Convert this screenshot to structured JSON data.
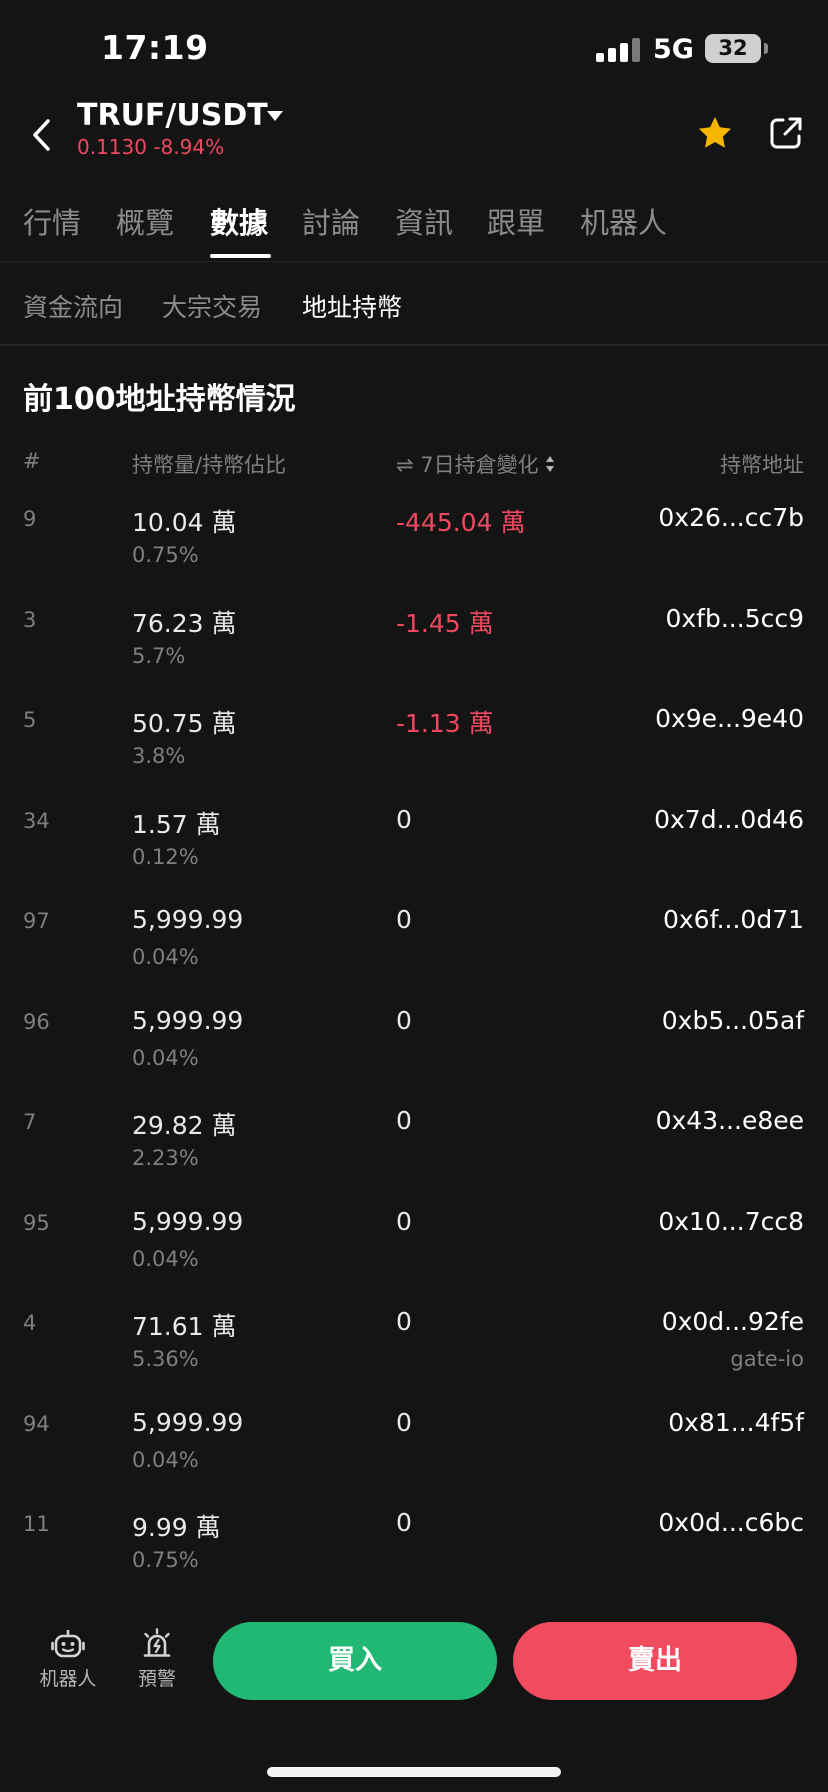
{
  "status_bar": {
    "time": "17:19",
    "network": "5G",
    "battery": "32"
  },
  "header": {
    "pair": "TRUF/USDT",
    "price_change": "0.1130 -8.94%"
  },
  "tabs": [
    {
      "label": "行情"
    },
    {
      "label": "概覽"
    },
    {
      "label": "數據",
      "active": true
    },
    {
      "label": "討論"
    },
    {
      "label": "資訊"
    },
    {
      "label": "跟單"
    },
    {
      "label": "机器人"
    }
  ],
  "subtabs": [
    {
      "label": "資金流向"
    },
    {
      "label": "大宗交易"
    },
    {
      "label": "地址持幣",
      "active": true
    }
  ],
  "section": {
    "title": "前100地址持幣情況",
    "columns": {
      "rank": "#",
      "holding": "持幣量/持幣佔比",
      "change_prefix": "⇌",
      "change": "7日持倉變化",
      "address": "持幣地址"
    }
  },
  "rows": [
    {
      "rank": "9",
      "amount": "10.04 萬",
      "pct": "0.75%",
      "change": "-445.04 萬",
      "negative": true,
      "address": "0x26...cc7b",
      "tag": ""
    },
    {
      "rank": "3",
      "amount": "76.23 萬",
      "pct": "5.7%",
      "change": "-1.45 萬",
      "negative": true,
      "address": "0xfb...5cc9",
      "tag": ""
    },
    {
      "rank": "5",
      "amount": "50.75 萬",
      "pct": "3.8%",
      "change": "-1.13 萬",
      "negative": true,
      "address": "0x9e...9e40",
      "tag": ""
    },
    {
      "rank": "34",
      "amount": "1.57 萬",
      "pct": "0.12%",
      "change": "0",
      "negative": false,
      "address": "0x7d...0d46",
      "tag": ""
    },
    {
      "rank": "97",
      "amount": "5,999.99",
      "pct": "0.04%",
      "change": "0",
      "negative": false,
      "address": "0x6f...0d71",
      "tag": ""
    },
    {
      "rank": "96",
      "amount": "5,999.99",
      "pct": "0.04%",
      "change": "0",
      "negative": false,
      "address": "0xb5...05af",
      "tag": ""
    },
    {
      "rank": "7",
      "amount": "29.82 萬",
      "pct": "2.23%",
      "change": "0",
      "negative": false,
      "address": "0x43...e8ee",
      "tag": ""
    },
    {
      "rank": "95",
      "amount": "5,999.99",
      "pct": "0.04%",
      "change": "0",
      "negative": false,
      "address": "0x10...7cc8",
      "tag": ""
    },
    {
      "rank": "4",
      "amount": "71.61 萬",
      "pct": "5.36%",
      "change": "0",
      "negative": false,
      "address": "0x0d...92fe",
      "tag": "gate-io"
    },
    {
      "rank": "94",
      "amount": "5,999.99",
      "pct": "0.04%",
      "change": "0",
      "negative": false,
      "address": "0x81...4f5f",
      "tag": ""
    },
    {
      "rank": "11",
      "amount": "9.99 萬",
      "pct": "0.75%",
      "change": "0",
      "negative": false,
      "address": "0x0d...c6bc",
      "tag": ""
    }
  ],
  "bottom_bar": {
    "robot_label": "机器人",
    "alert_label": "預警",
    "buy_label": "買入",
    "sell_label": "賣出"
  },
  "colors": {
    "background": "#141415",
    "negative": "#f0495f",
    "buy": "#21b873",
    "sell": "#f14b60",
    "star": "#f7b500"
  }
}
